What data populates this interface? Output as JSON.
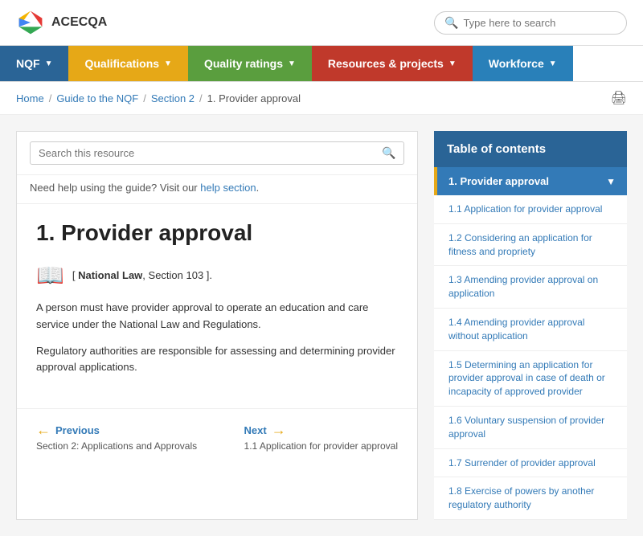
{
  "header": {
    "logo_text": "ACECQA",
    "search_placeholder": "Type here to search"
  },
  "nav": {
    "items": [
      {
        "id": "nqf",
        "label": "NQF",
        "class": "nav-nqf"
      },
      {
        "id": "qualifications",
        "label": "Qualifications",
        "class": "nav-qualifications"
      },
      {
        "id": "quality",
        "label": "Quality ratings",
        "class": "nav-quality"
      },
      {
        "id": "resources",
        "label": "Resources & projects",
        "class": "nav-resources"
      },
      {
        "id": "workforce",
        "label": "Workforce",
        "class": "nav-workforce"
      }
    ]
  },
  "breadcrumb": {
    "items": [
      "Home",
      "Guide to the NQF",
      "Section 2",
      "1. Provider approval"
    ]
  },
  "content": {
    "search_placeholder": "Search this resource",
    "help_text": "Need help using the guide? Visit our ",
    "help_link": "help section",
    "page_title": "1. Provider approval",
    "national_law": "[ National Law, Section 103 ].",
    "paragraph1": "A person must have provider approval to operate an education and care service under the National Law and Regulations.",
    "paragraph2": "Regulatory authorities are responsible for assessing and determining provider approval applications."
  },
  "pagination": {
    "prev_label": "Previous",
    "prev_section": "Section 2: Applications and Approvals",
    "next_label": "Next",
    "next_section": "1.1 Application for provider approval"
  },
  "toc": {
    "header": "Table of contents",
    "active_item": "1. Provider approval",
    "items": [
      "1.1 Application for provider approval",
      "1.2 Considering an application for fitness and propriety",
      "1.3 Amending provider approval on application",
      "1.4 Amending provider approval without application",
      "1.5 Determining an application for provider approval in case of death or incapacity of approved provider",
      "1.6 Voluntary suspension of provider approval",
      "1.7 Surrender of provider approval",
      "1.8 Exercise of powers by another regulatory authority"
    ]
  }
}
